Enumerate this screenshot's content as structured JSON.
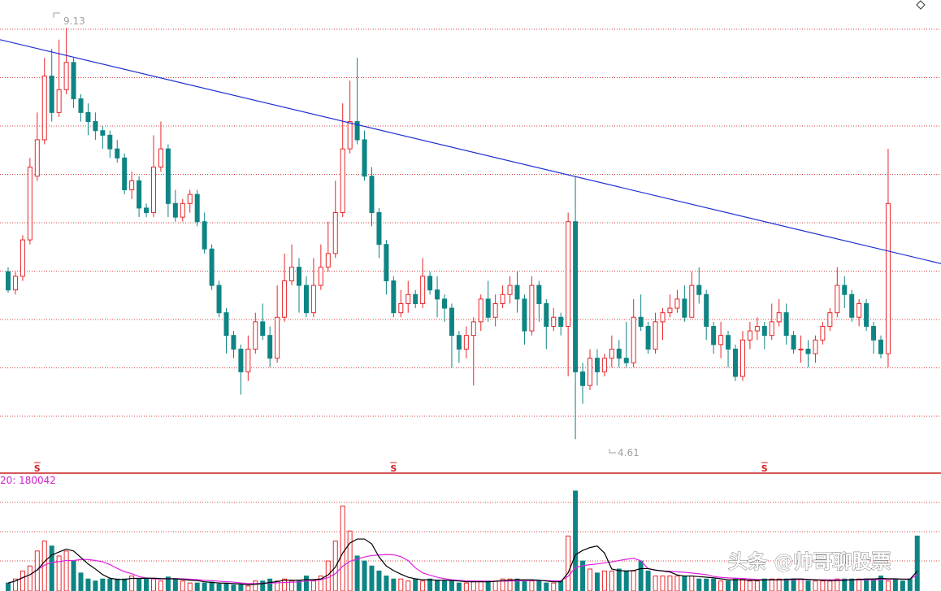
{
  "chart_data": {
    "type": "candlestick",
    "annotations": {
      "high_label": "9.13",
      "low_label": "4.61",
      "volume_header": "20: 180042",
      "dividend_marker": "S",
      "corner_icon": "diamond-icon"
    },
    "watermark": "头条 @帅哥聊股票",
    "colors": {
      "up": "#e8262b",
      "down": "#0e8584",
      "trendline": "#1f2fd0",
      "circle": "#2030d0",
      "grid": "#d84040",
      "ma_black": "#000000",
      "ma_magenta": "#e020e0",
      "volume_header": "#d020d0",
      "marker": "#d82020",
      "label_gray": "#a0a0a0"
    },
    "grid": true,
    "price_range": [
      4.3,
      9.4
    ],
    "volume_range": [
      0,
      1.0
    ],
    "trendline": {
      "start_index": 0,
      "start_price": 9.0,
      "end_index": 145,
      "end_price": 6.2
    },
    "circled_regions": [
      {
        "index": 141,
        "price": 6.75,
        "panel": "price"
      },
      {
        "index": 141,
        "volume": 0.55,
        "panel": "volume"
      }
    ],
    "dividend_marker_indices": [
      4,
      53,
      104
    ],
    "candles": [
      [
        6.45,
        6.25,
        6.5,
        6.22
      ],
      [
        6.25,
        6.4,
        6.45,
        6.2
      ],
      [
        6.4,
        6.8,
        6.85,
        6.35
      ],
      [
        6.8,
        7.6,
        7.7,
        6.75
      ],
      [
        7.5,
        7.9,
        8.2,
        7.45
      ],
      [
        7.9,
        8.6,
        8.8,
        7.85
      ],
      [
        8.6,
        8.2,
        8.9,
        8.1
      ],
      [
        8.2,
        8.45,
        9.0,
        8.15
      ],
      [
        8.45,
        8.75,
        9.13,
        8.4
      ],
      [
        8.75,
        8.35,
        8.8,
        8.25
      ],
      [
        8.35,
        8.2,
        8.4,
        8.1
      ],
      [
        8.2,
        8.1,
        8.3,
        7.95
      ],
      [
        8.1,
        8.0,
        8.2,
        7.9
      ],
      [
        8.0,
        7.95,
        8.05,
        7.8
      ],
      [
        7.95,
        7.8,
        8.0,
        7.7
      ],
      [
        7.8,
        7.7,
        7.9,
        7.65
      ],
      [
        7.7,
        7.35,
        7.75,
        7.3
      ],
      [
        7.35,
        7.45,
        7.55,
        7.25
      ],
      [
        7.45,
        7.15,
        7.5,
        7.05
      ],
      [
        7.15,
        7.1,
        7.2,
        7.05
      ],
      [
        7.1,
        7.6,
        7.95,
        7.05
      ],
      [
        7.6,
        7.8,
        8.1,
        7.55
      ],
      [
        7.8,
        7.2,
        7.85,
        7.05
      ],
      [
        7.2,
        7.05,
        7.35,
        7.0
      ],
      [
        7.05,
        7.2,
        7.25,
        7.0
      ],
      [
        7.2,
        7.3,
        7.35,
        7.1
      ],
      [
        7.3,
        7.0,
        7.35,
        6.95
      ],
      [
        7.0,
        6.7,
        7.1,
        6.65
      ],
      [
        6.7,
        6.3,
        6.75,
        6.25
      ],
      [
        6.3,
        6.0,
        6.35,
        5.95
      ],
      [
        6.0,
        5.75,
        6.05,
        5.55
      ],
      [
        5.75,
        5.6,
        5.8,
        5.5
      ],
      [
        5.6,
        5.35,
        5.65,
        5.1
      ],
      [
        5.35,
        5.6,
        5.75,
        5.25
      ],
      [
        5.6,
        5.9,
        6.0,
        5.55
      ],
      [
        5.9,
        5.75,
        6.1,
        5.7
      ],
      [
        5.75,
        5.5,
        5.85,
        5.4
      ],
      [
        5.5,
        5.95,
        6.3,
        5.45
      ],
      [
        5.95,
        6.35,
        6.65,
        5.9
      ],
      [
        6.35,
        6.5,
        6.75,
        6.3
      ],
      [
        6.5,
        6.3,
        6.6,
        6.0
      ],
      [
        6.3,
        6.0,
        6.4,
        5.95
      ],
      [
        6.0,
        6.3,
        6.6,
        5.95
      ],
      [
        6.3,
        6.5,
        6.75,
        6.25
      ],
      [
        6.5,
        6.65,
        7.0,
        6.45
      ],
      [
        6.65,
        7.1,
        7.45,
        6.6
      ],
      [
        7.1,
        7.8,
        8.3,
        7.05
      ],
      [
        7.8,
        8.1,
        8.55,
        7.75
      ],
      [
        8.1,
        7.9,
        8.8,
        7.85
      ],
      [
        7.9,
        7.5,
        8.0,
        7.45
      ],
      [
        7.5,
        7.1,
        7.6,
        6.95
      ],
      [
        7.1,
        6.75,
        7.15,
        6.6
      ],
      [
        6.75,
        6.35,
        6.8,
        6.2
      ],
      [
        6.35,
        6.0,
        6.4,
        5.95
      ],
      [
        6.0,
        6.1,
        6.25,
        5.95
      ],
      [
        6.1,
        6.2,
        6.35,
        6.0
      ],
      [
        6.2,
        6.1,
        6.25,
        6.05
      ],
      [
        6.1,
        6.4,
        6.6,
        6.05
      ],
      [
        6.4,
        6.25,
        6.45,
        6.2
      ],
      [
        6.25,
        6.15,
        6.4,
        5.95
      ],
      [
        6.15,
        6.05,
        6.2,
        5.9
      ],
      [
        6.05,
        5.75,
        6.1,
        5.4
      ],
      [
        5.75,
        5.6,
        5.8,
        5.45
      ],
      [
        5.6,
        5.75,
        5.85,
        5.5
      ],
      [
        5.75,
        5.9,
        5.95,
        5.2
      ],
      [
        5.9,
        6.15,
        6.2,
        5.8
      ],
      [
        6.15,
        5.95,
        6.35,
        5.9
      ],
      [
        5.95,
        6.1,
        6.2,
        5.85
      ],
      [
        6.1,
        6.2,
        6.3,
        6.05
      ],
      [
        6.2,
        6.3,
        6.4,
        6.1
      ],
      [
        6.3,
        6.15,
        6.45,
        6.0
      ],
      [
        6.15,
        5.8,
        6.2,
        5.65
      ],
      [
        5.8,
        6.3,
        6.4,
        5.75
      ],
      [
        6.3,
        6.1,
        6.35,
        5.9
      ],
      [
        6.1,
        5.85,
        6.15,
        5.6
      ],
      [
        5.85,
        5.95,
        6.05,
        5.8
      ],
      [
        5.95,
        5.85,
        6.0,
        5.75
      ],
      [
        5.85,
        7.0,
        7.1,
        5.3
      ],
      [
        7.0,
        5.35,
        7.5,
        4.61
      ],
      [
        5.35,
        5.2,
        5.45,
        5.0
      ],
      [
        5.2,
        5.5,
        5.6,
        5.15
      ],
      [
        5.5,
        5.35,
        5.6,
        5.2
      ],
      [
        5.35,
        5.5,
        5.55,
        5.3
      ],
      [
        5.5,
        5.6,
        5.75,
        5.4
      ],
      [
        5.6,
        5.5,
        5.7,
        5.4
      ],
      [
        5.5,
        5.45,
        5.9,
        5.4
      ],
      [
        5.45,
        5.95,
        6.15,
        5.4
      ],
      [
        5.95,
        5.85,
        6.2,
        5.8
      ],
      [
        5.85,
        5.6,
        5.9,
        5.55
      ],
      [
        5.6,
        5.9,
        6.0,
        5.55
      ],
      [
        5.9,
        6.0,
        6.05,
        5.7
      ],
      [
        6.0,
        6.05,
        6.2,
        5.95
      ],
      [
        6.05,
        6.15,
        6.25,
        6.0
      ],
      [
        6.15,
        5.95,
        6.3,
        5.9
      ],
      [
        5.95,
        6.3,
        6.45,
        5.95
      ],
      [
        6.3,
        6.2,
        6.5,
        6.1
      ],
      [
        6.2,
        5.85,
        6.25,
        5.7
      ],
      [
        5.85,
        5.65,
        5.9,
        5.55
      ],
      [
        5.65,
        5.75,
        5.9,
        5.5
      ],
      [
        5.75,
        5.6,
        5.8,
        5.4
      ],
      [
        5.6,
        5.3,
        5.65,
        5.25
      ],
      [
        5.3,
        5.7,
        5.8,
        5.25
      ],
      [
        5.7,
        5.8,
        5.9,
        5.6
      ],
      [
        5.8,
        5.85,
        5.95,
        5.7
      ],
      [
        5.85,
        5.75,
        5.9,
        5.6
      ],
      [
        5.75,
        5.9,
        6.1,
        5.7
      ],
      [
        5.9,
        6.0,
        6.15,
        5.85
      ],
      [
        6.0,
        5.75,
        6.1,
        5.65
      ],
      [
        5.75,
        5.6,
        5.8,
        5.55
      ],
      [
        5.6,
        5.6,
        5.75,
        5.45
      ],
      [
        5.6,
        5.55,
        5.7,
        5.4
      ],
      [
        5.55,
        5.7,
        5.75,
        5.45
      ],
      [
        5.7,
        5.85,
        5.9,
        5.65
      ],
      [
        5.85,
        6.0,
        6.05,
        5.8
      ],
      [
        6.0,
        6.3,
        6.5,
        5.95
      ],
      [
        6.3,
        6.2,
        6.4,
        6.05
      ],
      [
        6.2,
        5.95,
        6.25,
        5.9
      ],
      [
        5.95,
        6.1,
        6.15,
        5.85
      ],
      [
        6.1,
        5.85,
        6.15,
        5.8
      ],
      [
        5.85,
        5.7,
        5.9,
        5.55
      ],
      [
        5.7,
        5.55,
        5.75,
        5.5
      ],
      [
        5.55,
        7.2,
        7.8,
        5.4
      ]
    ],
    "volume": [
      0.08,
      0.12,
      0.2,
      0.25,
      0.4,
      0.5,
      0.45,
      0.35,
      0.4,
      0.3,
      0.18,
      0.12,
      0.1,
      0.12,
      0.12,
      0.12,
      0.12,
      0.15,
      0.12,
      0.13,
      0.12,
      0.1,
      0.14,
      0.12,
      0.1,
      0.08,
      0.08,
      0.08,
      0.09,
      0.07,
      0.07,
      0.06,
      0.06,
      0.05,
      0.1,
      0.1,
      0.12,
      0.1,
      0.12,
      0.1,
      0.1,
      0.15,
      0.1,
      0.15,
      0.3,
      0.5,
      0.85,
      0.6,
      0.35,
      0.3,
      0.25,
      0.2,
      0.15,
      0.12,
      0.12,
      0.1,
      0.12,
      0.1,
      0.12,
      0.1,
      0.1,
      0.1,
      0.08,
      0.08,
      0.1,
      0.1,
      0.1,
      0.1,
      0.12,
      0.12,
      0.12,
      0.1,
      0.1,
      0.1,
      0.08,
      0.08,
      0.1,
      0.55,
      1.0,
      0.3,
      0.22,
      0.18,
      0.2,
      0.2,
      0.22,
      0.2,
      0.2,
      0.3,
      0.2,
      0.15,
      0.15,
      0.15,
      0.15,
      0.15,
      0.15,
      0.12,
      0.12,
      0.12,
      0.1,
      0.1,
      0.12,
      0.12,
      0.1,
      0.1,
      0.12,
      0.12,
      0.12,
      0.12,
      0.12,
      0.12,
      0.1,
      0.1,
      0.1,
      0.1,
      0.12,
      0.12,
      0.12,
      0.12,
      0.12,
      0.12,
      0.15,
      0.1,
      0.12,
      0.1,
      0.12,
      0.55
    ]
  }
}
